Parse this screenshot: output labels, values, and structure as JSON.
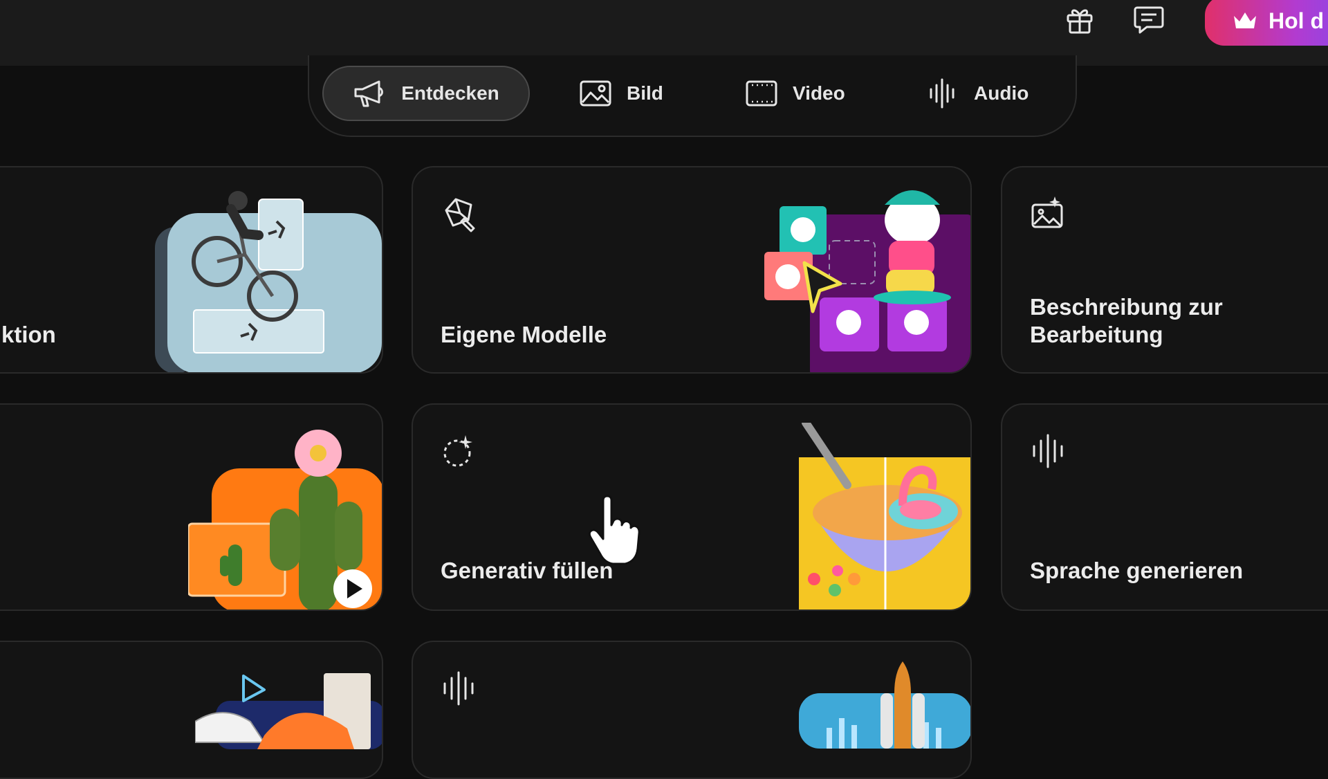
{
  "topbar": {
    "gift_icon": "gift-icon",
    "chat_icon": "chat-icon",
    "upgrade_label": "Hol d",
    "upgrade_icon": "crown-icon",
    "upgrade_colors": [
      "#e0306a",
      "#7b4cf0"
    ]
  },
  "tabs": [
    {
      "label": "Entdecken",
      "icon": "megaphone-icon",
      "active": true
    },
    {
      "label": "Bild",
      "icon": "image-icon",
      "active": false
    },
    {
      "label": "Video",
      "icon": "film-icon",
      "active": false
    },
    {
      "label": "Audio",
      "icon": "waveform-icon",
      "active": false
    }
  ],
  "cards": {
    "row1_left": {
      "title": "ktion"
    },
    "eigene_modelle": {
      "title": "Eigene Modelle",
      "icon": "custom-model-icon"
    },
    "beschreibung": {
      "title_line1": "Beschreibung zur",
      "title_line2": "Bearbeitung",
      "icon": "image-edit-icon"
    },
    "generativ": {
      "title": "Generativ füllen",
      "icon": "generative-fill-icon"
    },
    "sprache": {
      "title": "Sprache generieren",
      "icon": "waveform-icon"
    },
    "row3_mid": {
      "icon": "waveform-icon"
    }
  }
}
